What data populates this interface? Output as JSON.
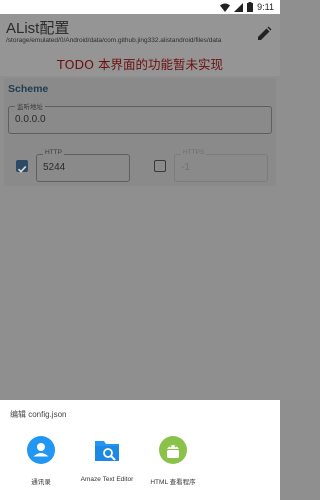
{
  "status_bar": {
    "time": "9:11",
    "icons": [
      "wifi-icon",
      "signal-icon",
      "battery-icon"
    ]
  },
  "header": {
    "title": "AList配置",
    "path": "/storage/emulated/0/Android/data/com.github.jing332.alistandroid/files/data",
    "todo_notice": "TODO 本界面的功能暂未实现",
    "todo_color": "#6e1010"
  },
  "scheme": {
    "title": "Scheme",
    "address_label": "监听地址",
    "address_value": "0.0.0.0",
    "http": {
      "label": "HTTP",
      "value": "5244",
      "checked": true
    },
    "https": {
      "label": "HTTPS",
      "value": "-1",
      "checked": false
    },
    "accent_color": "#1f3b55"
  },
  "share_sheet": {
    "title": "编辑 config.json",
    "options": [
      {
        "label": "通讯录",
        "icon": "contacts-icon",
        "color": "#2196f3"
      },
      {
        "label": "Amaze Text Editor",
        "icon": "text-editor-icon",
        "color": "#2196f3"
      },
      {
        "label": "HTML 查看程序",
        "icon": "android-icon",
        "color": "#8bc34a"
      }
    ]
  }
}
